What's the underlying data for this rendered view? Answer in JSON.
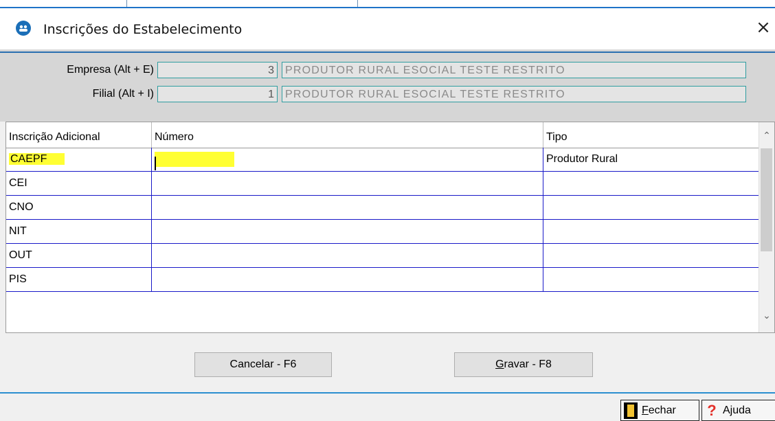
{
  "window": {
    "title": "Inscrições do Estabelecimento",
    "close_glyph": "×"
  },
  "filters": {
    "empresa": {
      "label": "Empresa (Alt + E)",
      "code": "3",
      "name": "PRODUTOR RURAL ESOCIAL TESTE RESTRITO"
    },
    "filial": {
      "label": "Filial (Alt + I)",
      "code": "1",
      "name": "PRODUTOR RURAL ESOCIAL TESTE RESTRITO"
    }
  },
  "grid": {
    "columns": [
      "Inscrição Adicional",
      "Número",
      "Tipo"
    ],
    "rows": [
      {
        "inscricao": "CAEPF",
        "numero": "",
        "tipo": "Produtor Rural"
      },
      {
        "inscricao": "CEI",
        "numero": "",
        "tipo": ""
      },
      {
        "inscricao": "CNO",
        "numero": "",
        "tipo": ""
      },
      {
        "inscricao": "NIT",
        "numero": "",
        "tipo": ""
      },
      {
        "inscricao": "OUT",
        "numero": "",
        "tipo": ""
      },
      {
        "inscricao": "PIS",
        "numero": "",
        "tipo": ""
      }
    ],
    "highlight_color": "#ffff33"
  },
  "buttons": {
    "cancelar": "Cancelar - F6",
    "gravar_first": "G",
    "gravar_rest": "ravar - F8"
  },
  "footer": {
    "fechar_first": "F",
    "fechar_rest": "echar",
    "ajuda": "Ajuda"
  },
  "icons": {
    "app": "app-logo-icon",
    "close": "close-icon",
    "scroll_up": "chevron-up-icon",
    "scroll_down": "chevron-down-icon",
    "fechar": "door-exit-icon",
    "ajuda": "help-question-icon"
  }
}
